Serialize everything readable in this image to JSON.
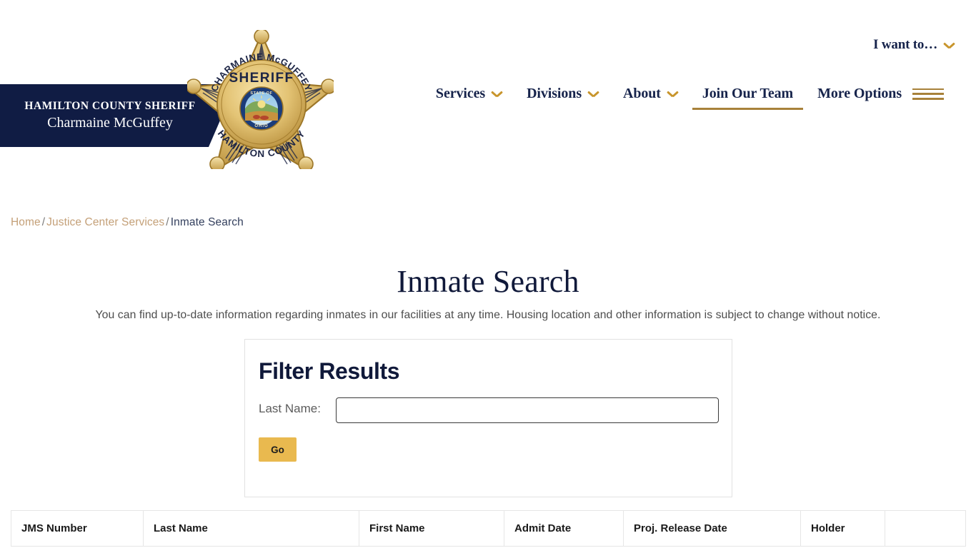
{
  "header": {
    "utility": {
      "label": "I want to…",
      "chevron_icon": "chevron-down-icon"
    },
    "banner": {
      "office": "HAMILTON COUNTY SHERIFF",
      "name": "Charmaine McGuffey"
    },
    "badge": {
      "top_text": "CHARMAINE McGUFFEY",
      "center_text": "SHERIFF",
      "bottom_text": "HAMILTON COUNTY",
      "seal_top": "STATE OF",
      "seal_bottom": "OHIO"
    },
    "nav": [
      {
        "label": "Services",
        "has_chevron": true,
        "active": false
      },
      {
        "label": "Divisions",
        "has_chevron": true,
        "active": false
      },
      {
        "label": "About",
        "has_chevron": true,
        "active": false
      },
      {
        "label": "Join Our Team",
        "has_chevron": false,
        "active": true
      },
      {
        "label": "More Options",
        "has_chevron": false,
        "active": false
      }
    ]
  },
  "breadcrumb": {
    "items": [
      {
        "label": "Home",
        "current": false
      },
      {
        "label": "Justice Center Services",
        "current": false
      },
      {
        "label": "Inmate Search",
        "current": true
      }
    ],
    "separator": "/"
  },
  "main": {
    "title": "Inmate Search",
    "description": "You can find up-to-date information regarding inmates in our facilities at any time. Housing location and other information is subject to change without notice."
  },
  "filter": {
    "title": "Filter Results",
    "last_name_label": "Last Name:",
    "last_name_value": "",
    "last_name_placeholder": "",
    "go_label": "Go"
  },
  "results": {
    "columns": [
      "JMS Number",
      "Last Name",
      "First Name",
      "Admit Date",
      "Proj. Release Date",
      "Holder",
      ""
    ],
    "rows": []
  },
  "colors": {
    "navy": "#101c44",
    "gold": "#c8952c",
    "gold_button": "#e9b94f",
    "breadcrumb_link": "#c4a078",
    "underline": "#a8813a"
  }
}
